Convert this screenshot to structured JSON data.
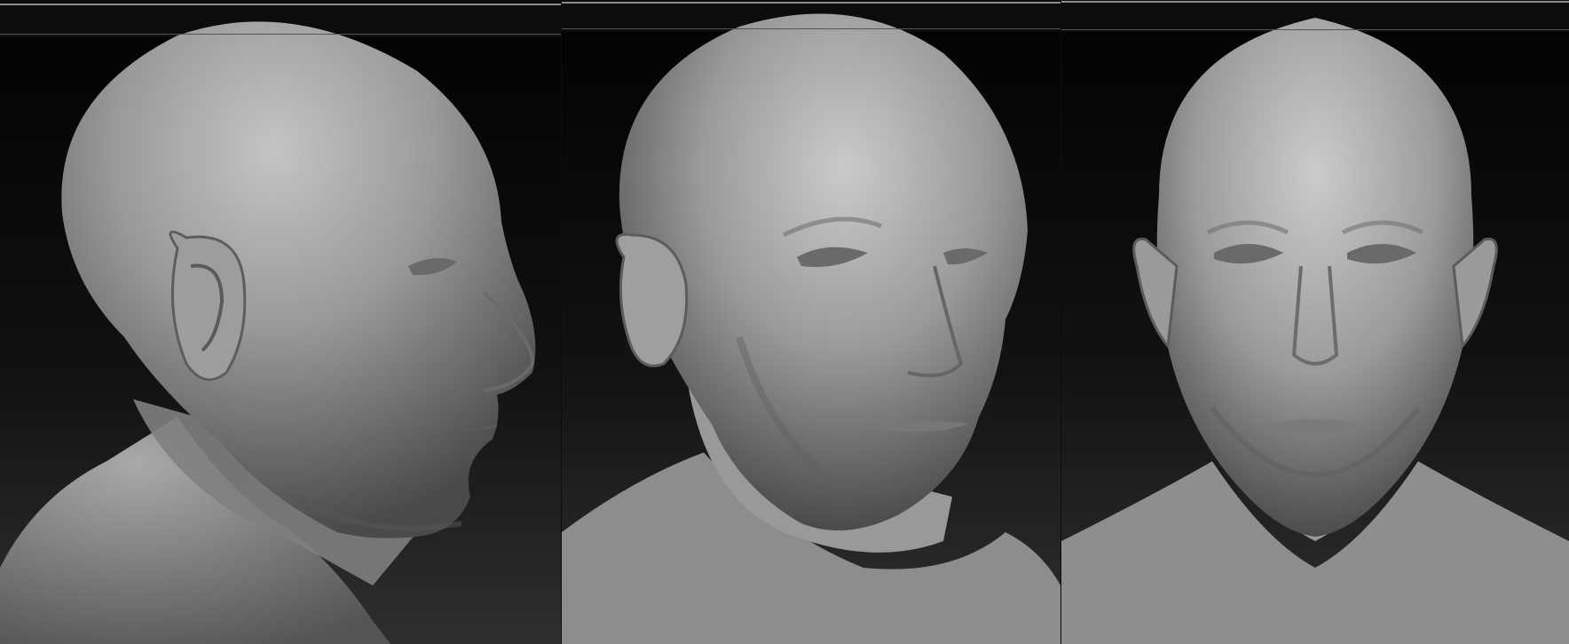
{
  "image": {
    "panel_count": 3,
    "panels": [
      {
        "view": "profile",
        "icon": "head-profile-right"
      },
      {
        "view": "three-quarter",
        "icon": "head-three-quarter-right"
      },
      {
        "view": "front",
        "icon": "head-front"
      }
    ],
    "colors": {
      "background_top": "#050505",
      "background_bottom": "#2e2e2e",
      "skin_light": "#bdbdbd",
      "skin_mid": "#8a8a8a",
      "skin_dark": "#3a3a3a",
      "frame_line": "#8c8c8c"
    }
  }
}
